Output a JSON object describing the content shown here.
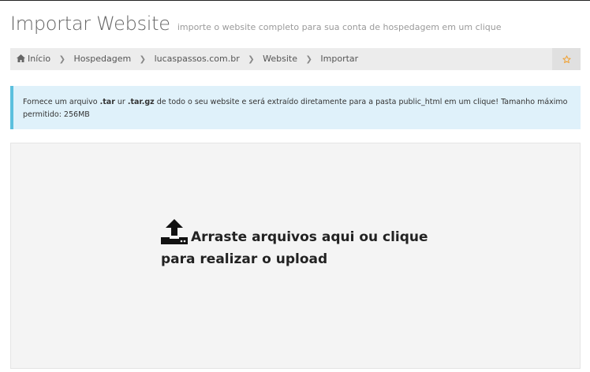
{
  "header": {
    "title": "Importar Website",
    "subtitle": "importe o website completo para sua conta de hospedagem em um clique"
  },
  "breadcrumb": {
    "items": [
      "Início",
      "Hospedagem",
      "lucaspassos.com.br",
      "Website",
      "Importar"
    ]
  },
  "alert": {
    "text_before": "Fornece um arquivo ",
    "ext1": ".tar",
    "text_mid": " ur ",
    "ext2": ".tar.gz",
    "text_after": " de todo o seu website e será extraído diretamente para a pasta public_html em um clique! Tamanho máximo permitido: 256MB"
  },
  "dropzone": {
    "message": "Arraste arquivos aqui ou clique para realizar o upload",
    "icon": "upload-icon"
  },
  "colors": {
    "accent_star": "#f0a030",
    "alert_border": "#5bc0de",
    "alert_bg": "#dff1fa"
  }
}
